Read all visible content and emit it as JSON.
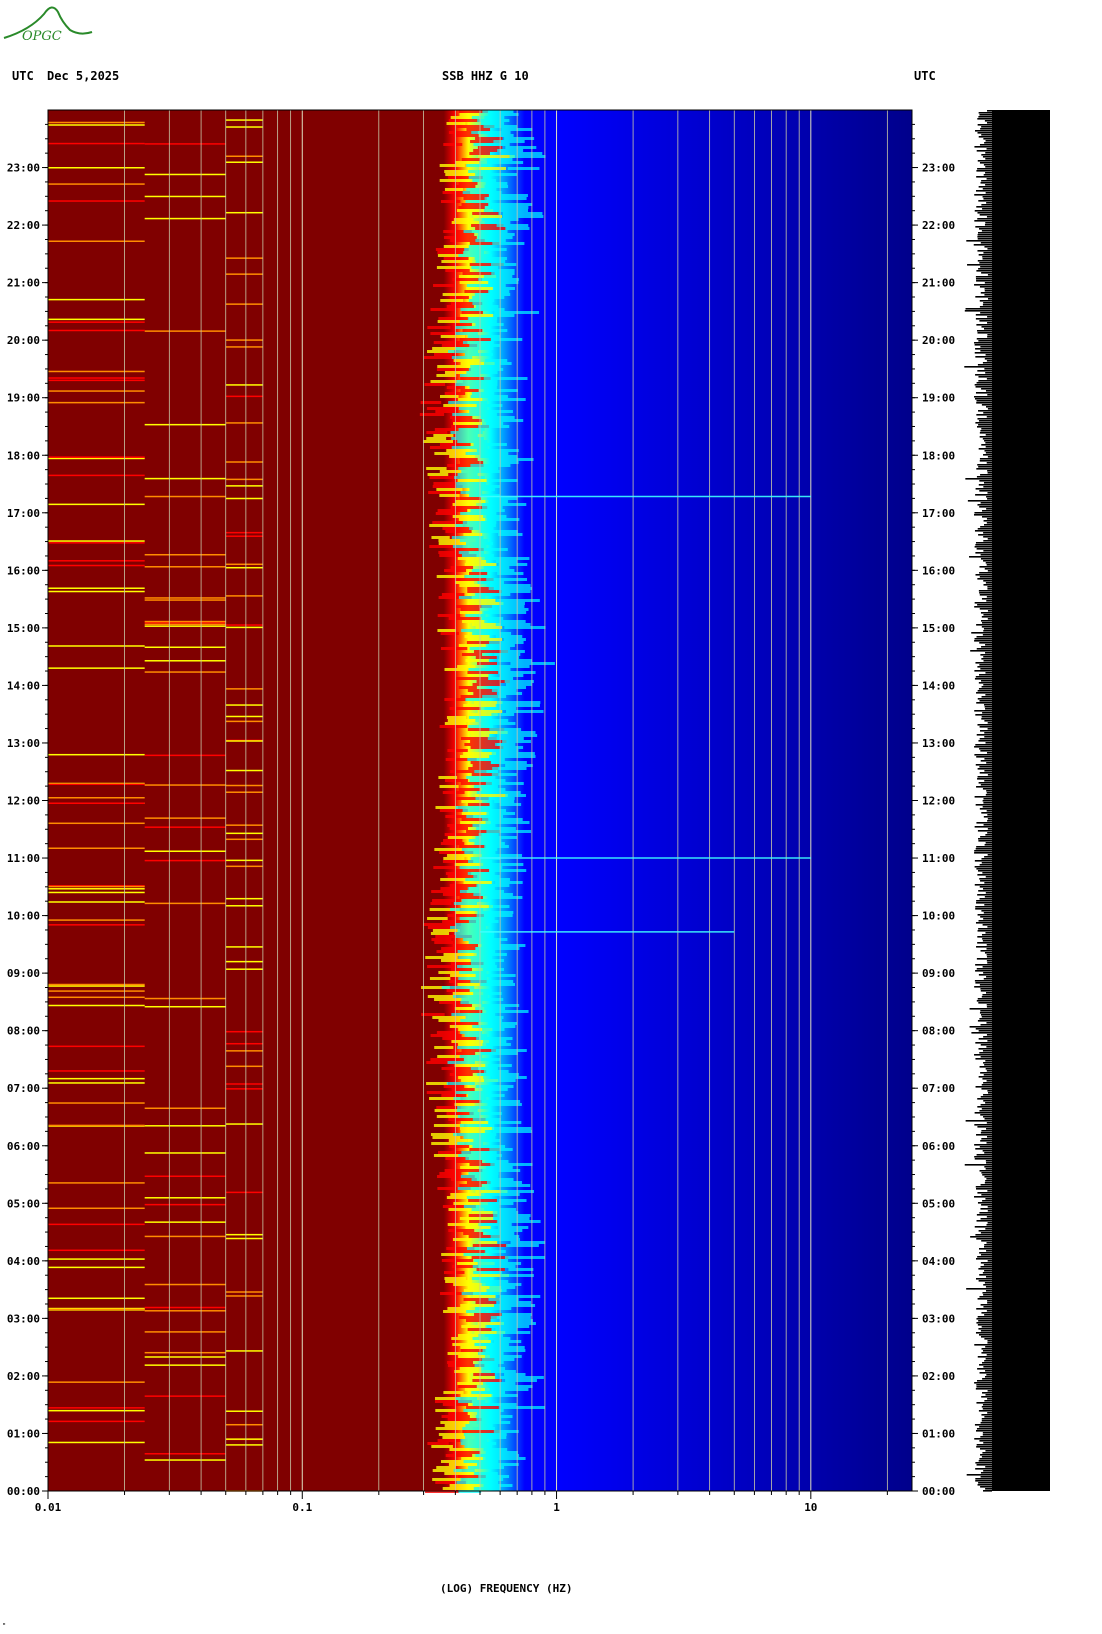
{
  "header": {
    "left_utc": "UTC",
    "date": "Dec 5,2025",
    "station": "SSB HHZ G 10",
    "right_utc": "UTC"
  },
  "logo": {
    "text": "OPGC",
    "color": "#2a8a2a"
  },
  "footer_mark": "\"",
  "chart_data": {
    "type": "heatmap",
    "title": "SSB HHZ G 10",
    "xlabel": "(LOG) FREQUENCY (HZ)",
    "ylabel": "",
    "x_scale": "log",
    "xlim": [
      0.01,
      25
    ],
    "x_ticks": [
      {
        "value": 0.01,
        "label": "0.01"
      },
      {
        "value": 0.1,
        "label": "0.1"
      },
      {
        "value": 1,
        "label": "1"
      },
      {
        "value": 10,
        "label": "10"
      }
    ],
    "x_minor_gridlines": [
      0.02,
      0.03,
      0.04,
      0.05,
      0.06,
      0.07,
      0.08,
      0.09,
      0.2,
      0.3,
      0.4,
      0.5,
      0.6,
      0.7,
      0.8,
      0.9,
      2,
      3,
      4,
      5,
      6,
      7,
      8,
      9,
      20
    ],
    "y_range_hours": [
      0,
      24
    ],
    "y_ticks": [
      "00:00",
      "01:00",
      "02:00",
      "03:00",
      "04:00",
      "05:00",
      "06:00",
      "07:00",
      "08:00",
      "09:00",
      "10:00",
      "11:00",
      "12:00",
      "13:00",
      "14:00",
      "15:00",
      "16:00",
      "17:00",
      "18:00",
      "19:00",
      "20:00",
      "21:00",
      "22:00",
      "23:00"
    ],
    "colormap": [
      "#800000",
      "#ff0000",
      "#ffff00",
      "#00ffff",
      "#0000ff",
      "#00008b"
    ],
    "transition_freq_hz": 0.5,
    "high_freq_events": [
      {
        "time": "17:17",
        "freq_range": [
          0.5,
          10
        ]
      },
      {
        "time": "11:00",
        "freq_range": [
          0.5,
          10
        ]
      },
      {
        "time": "09:43",
        "freq_range": [
          0.5,
          5
        ]
      }
    ],
    "trace_panel": "seismogram"
  }
}
